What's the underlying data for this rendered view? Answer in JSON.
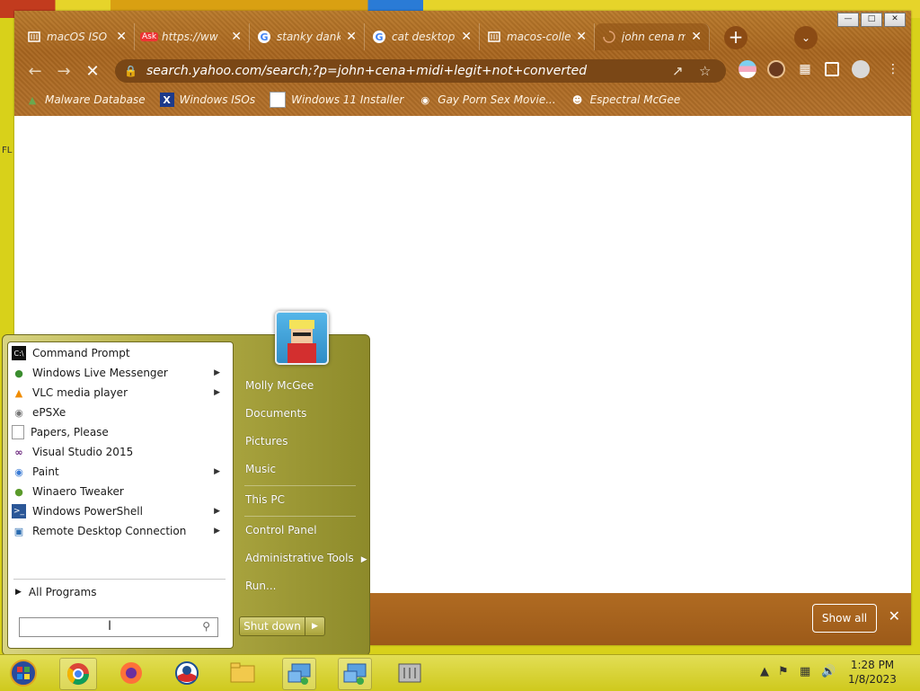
{
  "browser": {
    "tabs": [
      {
        "label": "macOS ISO",
        "icon": "archive-icon"
      },
      {
        "label": "https://ww",
        "icon": "ask-icon"
      },
      {
        "label": "stanky dank",
        "icon": "google-icon"
      },
      {
        "label": "cat desktop",
        "icon": "google-icon"
      },
      {
        "label": "macos-colle",
        "icon": "archive-icon"
      },
      {
        "label": "john cena m",
        "icon": "loading-icon"
      }
    ],
    "url": "search.yahoo.com/search;?p=john+cena+midi+legit+not+converted",
    "bookmarks": [
      {
        "label": "Malware Database"
      },
      {
        "label": "Windows ISOs"
      },
      {
        "label": "Windows 11 Installer"
      },
      {
        "label": "Gay Porn Sex Movie..."
      },
      {
        "label": "Espectral McGee"
      }
    ],
    "download_bar": {
      "show_all": "Show all"
    }
  },
  "start_menu": {
    "programs": [
      {
        "label": "Command Prompt",
        "submenu": false
      },
      {
        "label": "Windows Live Messenger",
        "submenu": true
      },
      {
        "label": "VLC media player",
        "submenu": true
      },
      {
        "label": "ePSXe",
        "submenu": false
      },
      {
        "label": "Papers, Please",
        "submenu": false
      },
      {
        "label": "Visual Studio 2015",
        "submenu": false
      },
      {
        "label": "Paint",
        "submenu": true
      },
      {
        "label": "Winaero Tweaker",
        "submenu": false
      },
      {
        "label": "Windows PowerShell",
        "submenu": true
      },
      {
        "label": "Remote Desktop Connection",
        "submenu": true
      }
    ],
    "all_programs": "All Programs",
    "right": {
      "user": "Molly McGee",
      "documents": "Documents",
      "pictures": "Pictures",
      "music": "Music",
      "this_pc": "This PC",
      "control_panel": "Control Panel",
      "admin_tools": "Administrative Tools",
      "run": "Run..."
    },
    "shutdown": "Shut down"
  },
  "taskbar": {
    "time": "1:28 PM",
    "date": "1/8/2023"
  },
  "colors": {
    "chrome_theme": "#a9661f",
    "taskbar": "#cfc91d",
    "start_menu": "#b8b24a"
  }
}
